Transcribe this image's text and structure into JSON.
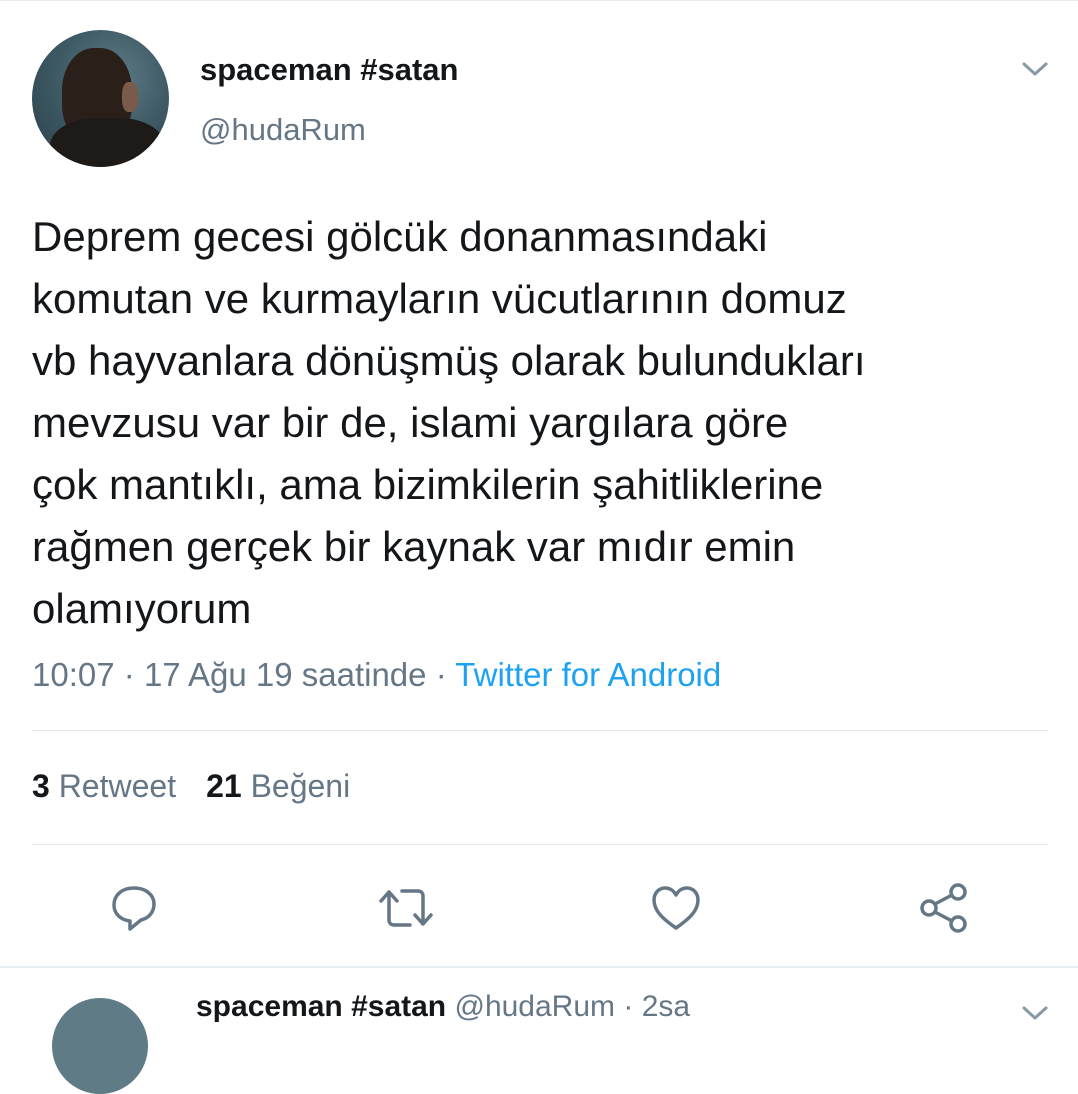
{
  "tweet": {
    "display_name": "spaceman #satan",
    "handle": "@hudaRum",
    "text_lines": [
      "Deprem gecesi gölcük donanmasındaki",
      "komutan ve kurmayların vücutlarının domuz",
      "vb hayvanlara dönüşmüş olarak bulundukları",
      "mevzusu var bir de, islami yargılara göre",
      "çok mantıklı, ama bizimkilerin şahitliklerine",
      "rağmen gerçek bir kaynak var mıdır emin",
      "olamıyorum"
    ],
    "time": "10:07",
    "separator": "·",
    "date": "17 Ağu 19 saatinde",
    "source": "Twitter for Android",
    "retweet_count": "3",
    "retweet_label": "Retweet",
    "like_count": "21",
    "like_label": "Beğeni"
  },
  "actions": {
    "icons": [
      "reply-icon",
      "retweet-icon",
      "like-icon",
      "share-icon"
    ]
  },
  "next_tweet": {
    "display_name": "spaceman #satan",
    "handle": "@hudaRum",
    "time_partial": "· 2sa"
  },
  "colors": {
    "text": "#14171a",
    "secondary": "#657786",
    "link": "#1da1f2",
    "divider": "#e1e8ed"
  }
}
